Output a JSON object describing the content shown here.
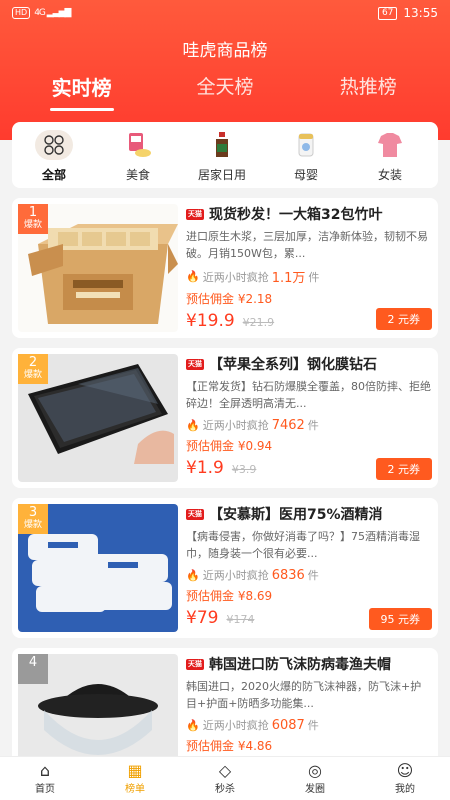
{
  "status_bar": {
    "network": "HD",
    "signal": "4G",
    "battery": "67",
    "time": "13:55"
  },
  "app_title": "哇虎商品榜",
  "tabs": [
    {
      "label": "实时榜",
      "active": true
    },
    {
      "label": "全天榜",
      "active": false
    },
    {
      "label": "热推榜",
      "active": false
    }
  ],
  "categories": [
    {
      "label": "全部",
      "icon": "grid-icon",
      "active": true
    },
    {
      "label": "美食",
      "icon": "food-icon",
      "active": false
    },
    {
      "label": "居家日用",
      "icon": "bottle-icon",
      "active": false
    },
    {
      "label": "母婴",
      "icon": "milk-powder-icon",
      "active": false
    },
    {
      "label": "女装",
      "icon": "shirt-icon",
      "active": false
    }
  ],
  "products": [
    {
      "rank": "1",
      "badge": "爆款",
      "title": "现货秒发！一大箱32包竹叶",
      "desc": "进口原生木浆，三层加厚，洁净新体验，韧韧不易破。月销150W包，累...",
      "sales_prefix": "近两小时疯抢",
      "sales": "1.1万",
      "sales_unit": "件",
      "commission": "预估佣金 ¥2.18",
      "price": "¥19.9",
      "orig_price": "¥21.9",
      "coupon": "2 元券"
    },
    {
      "rank": "2",
      "badge": "爆款",
      "title": "【苹果全系列】钢化膜钻石",
      "desc": "【正常发货】钻石防爆膜全覆盖，80倍防摔、拒绝碎边！全屏透明高清无...",
      "sales_prefix": "近两小时疯抢",
      "sales": "7462",
      "sales_unit": "件",
      "commission": "预估佣金 ¥0.94",
      "price": "¥1.9",
      "orig_price": "¥3.9",
      "coupon": "2 元券"
    },
    {
      "rank": "3",
      "badge": "爆款",
      "title": "【安慕斯】医用75%酒精消",
      "desc": "【病毒侵害，你做好消毒了吗？】75酒精消毒湿巾，随身装一个很有必要...",
      "sales_prefix": "近两小时疯抢",
      "sales": "6836",
      "sales_unit": "件",
      "commission": "预估佣金 ¥8.69",
      "price": "¥79",
      "orig_price": "¥174",
      "coupon": "95 元券"
    },
    {
      "rank": "4",
      "badge": "",
      "title": "韩国进口防飞沫防病毒渔夫帽",
      "desc": "韩国进口，2020火爆的防飞沫神器，防飞沫+护目+护面+防晒多功能集...",
      "sales_prefix": "近两小时疯抢",
      "sales": "6087",
      "sales_unit": "件",
      "commission": "预估佣金 ¥4.86",
      "price": "",
      "orig_price": "",
      "coupon": ""
    }
  ],
  "bottom_nav": [
    {
      "label": "首页",
      "icon": "home-icon",
      "active": false
    },
    {
      "label": "榜单",
      "icon": "ranking-grid-icon",
      "active": true
    },
    {
      "label": "秒杀",
      "icon": "diamond-icon",
      "active": false
    },
    {
      "label": "发圈",
      "icon": "share-circle-icon",
      "active": false
    },
    {
      "label": "我的",
      "icon": "user-icon",
      "active": false
    }
  ],
  "colors": {
    "brand": "#ff4a30",
    "price": "#ff3b1f",
    "nav_active": "#f0a000"
  }
}
